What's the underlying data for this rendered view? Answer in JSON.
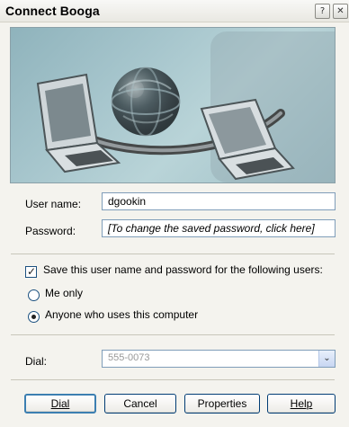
{
  "window": {
    "title": "Connect Booga",
    "help_glyph": "?",
    "close_glyph": "✕"
  },
  "form": {
    "user_name_label": "User name:",
    "user_name_value": "dgookin",
    "password_label": "Password:",
    "password_value": "[To change the saved password, click here]"
  },
  "save": {
    "label": "Save this user name and password for the following users:",
    "checked": true,
    "options": [
      {
        "label": "Me only",
        "selected": false
      },
      {
        "label": "Anyone who uses this computer",
        "selected": true
      }
    ]
  },
  "dial": {
    "label": "Dial:",
    "value": "555-0073",
    "dropdown_glyph": "⌄"
  },
  "buttons": {
    "dial": "Dial",
    "cancel": "Cancel",
    "properties": "Properties",
    "help": "Help"
  },
  "icons": {
    "help": "help-question-icon",
    "close": "close-icon",
    "globe": "globe-icon",
    "laptop": "laptop-icon",
    "dropdown": "chevron-down-icon"
  }
}
